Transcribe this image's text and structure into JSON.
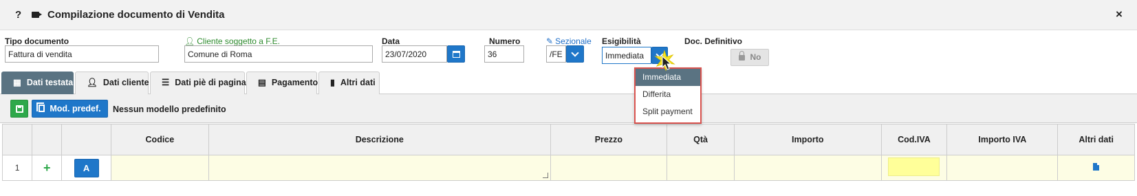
{
  "window": {
    "help": "?",
    "title": "Compilazione documento di Vendita",
    "close": "×"
  },
  "form": {
    "tipo_label": "Tipo documento",
    "tipo_value": "Fattura di vendita",
    "cliente_label": "Cliente soggetto a F.E.",
    "cliente_value": "Comune di Roma",
    "data_label": "Data",
    "data_value": "23/07/2020",
    "numero_label": "Numero",
    "numero_value": "36",
    "sezionale_label": "Sezionale",
    "sezionale_value": "/FE",
    "esig_label": "Esigibilità",
    "esig_value": "Immediata",
    "definitivo_label": "Doc. Definitivo",
    "definitivo_value": "No"
  },
  "dropdown": {
    "options": [
      "Immediata",
      "Differita",
      "Split payment"
    ],
    "selected": "Immediata"
  },
  "tabs": [
    {
      "label": "Dati testata",
      "icon": "table-icon",
      "active": true
    },
    {
      "label": "Dati cliente",
      "icon": "user-icon"
    },
    {
      "label": "Dati piè di pagina",
      "icon": "list-icon"
    },
    {
      "label": "Pagamento",
      "icon": "calendar-icon"
    },
    {
      "label": "Altri dati",
      "icon": "file-icon"
    }
  ],
  "toolbar": {
    "mod_label": "Mod. predef.",
    "model_text": "Nessun modello predefinito"
  },
  "grid": {
    "headers": [
      "",
      "",
      "",
      "Codice",
      "Descrizione",
      "Prezzo",
      "Qtà",
      "Importo",
      "Cod.IVA",
      "Importo IVA",
      "Altri dati"
    ],
    "rows": [
      {
        "num": "1",
        "action": "A"
      }
    ],
    "plus": "+"
  },
  "colors": {
    "accent": "#1f77c9",
    "active_tab": "#5a7382",
    "row_bg": "#fdfde4",
    "iva_bg": "#ffff99",
    "dropdown_border": "#d9534f"
  }
}
